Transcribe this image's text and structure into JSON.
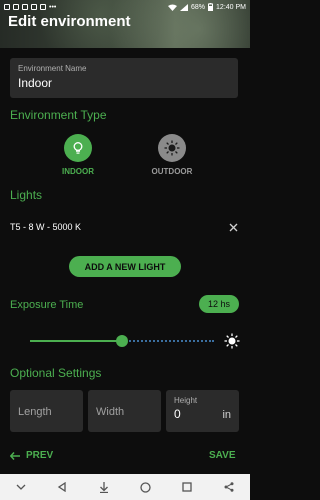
{
  "status_bar": {
    "battery": "68%",
    "time": "12:40 PM"
  },
  "header": {
    "title": "Edit environment"
  },
  "environment_name": {
    "label": "Environment Name",
    "value": "Indoor"
  },
  "environment_type": {
    "title": "Environment Type",
    "options": [
      {
        "label": "INDOOR",
        "icon": "lightbulb-icon",
        "selected": true
      },
      {
        "label": "OUTDOOR",
        "icon": "sun-icon",
        "selected": false
      }
    ]
  },
  "lights": {
    "title": "Lights",
    "items": [
      {
        "label": "T5 - 8 W - 5000 K"
      }
    ],
    "add_button": "ADD A NEW LIGHT"
  },
  "exposure": {
    "title": "Exposure Time",
    "value": "12 hs",
    "level": 0.5
  },
  "optional": {
    "title": "Optional Settings",
    "length_placeholder": "Length",
    "width_placeholder": "Width",
    "height_label": "Height",
    "height_value": "0",
    "height_unit": "in"
  },
  "footer": {
    "prev": "PREV",
    "save": "SAVE"
  },
  "colors": {
    "accent": "#4caf50",
    "background": "#0d0d0d",
    "field": "#2b2b2b",
    "inactive": "#8a8a8a"
  }
}
